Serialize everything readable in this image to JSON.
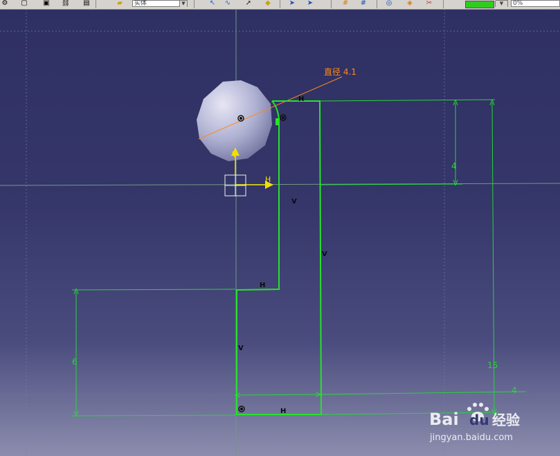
{
  "toolbar": {
    "icons": [
      "settings-icon",
      "document-icon",
      "print-preview-icon",
      "link-icon",
      "save-icon",
      "folder-icon",
      "cursor-icon",
      "spline-icon",
      "pointer-icon",
      "fill-icon",
      "select-icon",
      "select-all-icon",
      "grid-icon",
      "snap-grid-icon",
      "sketch-analysis-icon",
      "constraint-icon",
      "cut-icon"
    ],
    "style_combo_value": "实体",
    "percent_combo_value": "0%",
    "color_swatch": "#2ecc1f"
  },
  "dimensions": {
    "diameter": "直径 4.1",
    "top_height": "4",
    "left_height": "6",
    "total_height": "15",
    "bottom_width": "4"
  },
  "constraints": {
    "horizontal": "H",
    "vertical": "V"
  },
  "axis": {
    "h_label": "H",
    "v_label": "V"
  },
  "watermark": {
    "brand_a": "Bai",
    "brand_b": "du",
    "jingyan": "经验",
    "url": "jingyan.baidu.com"
  },
  "colors": {
    "sketch": "#27e22a",
    "dimension": "#27d63a",
    "diameter": "#ff8a1a",
    "axis": "#f0e000",
    "background_top": "#2e2f63",
    "background_bottom": "#8c8dae"
  }
}
